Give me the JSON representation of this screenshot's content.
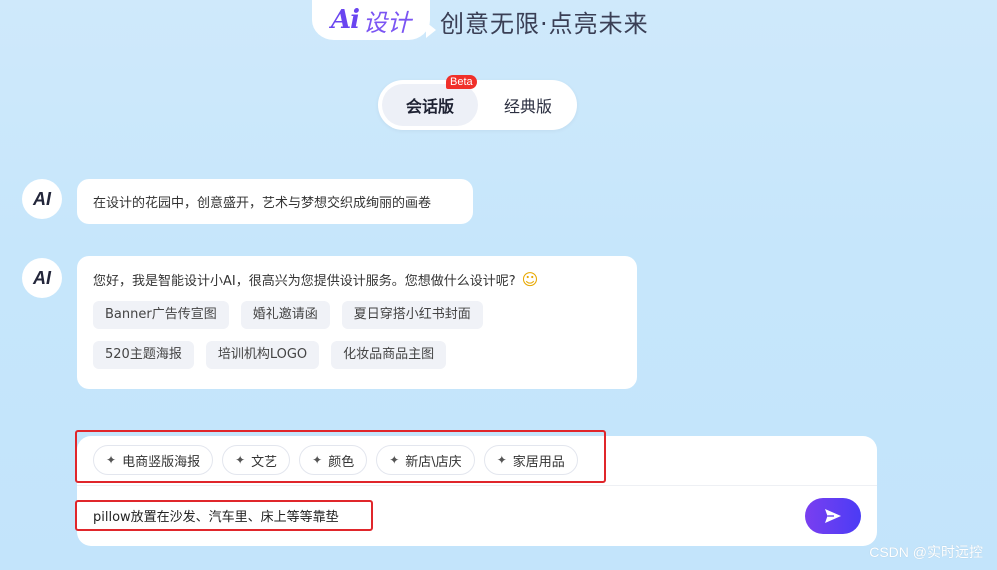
{
  "header": {
    "logo_mark": "Ai",
    "logo_text": "设计",
    "slogan": "创意无限·点亮未来"
  },
  "mode_switch": {
    "active_label": "会话版",
    "badge": "Beta",
    "inactive_label": "经典版"
  },
  "chat": {
    "avatar_text": "AI",
    "messages": [
      {
        "text": "在设计的花园中，创意盛开，艺术与梦想交织成绚丽的画卷"
      },
      {
        "text": "您好，我是智能设计小AI，很高兴为您提供设计服务。您想做什么设计呢?",
        "emoji": "☺",
        "suggestions": [
          [
            "Banner广告传宣图",
            "婚礼邀请函",
            "夏日穿搭小红书封面"
          ],
          [
            "520主题海报",
            "培训机构LOGO",
            "化妆品商品主图"
          ]
        ]
      }
    ]
  },
  "input": {
    "tags": [
      "电商竖版海报",
      "文艺",
      "颜色",
      "新店\\店庆",
      "家居用品"
    ],
    "value": "pillow放置在沙发、汽车里、床上等等靠垫",
    "send_icon": "send-icon"
  },
  "watermark": "CSDN @实时远控",
  "colors": {
    "accent": "#6a45f0",
    "send_gradient_start": "#7a3ff0",
    "send_gradient_end": "#4b3cf5",
    "badge": "#f0302a",
    "highlight": "#e0262b"
  }
}
